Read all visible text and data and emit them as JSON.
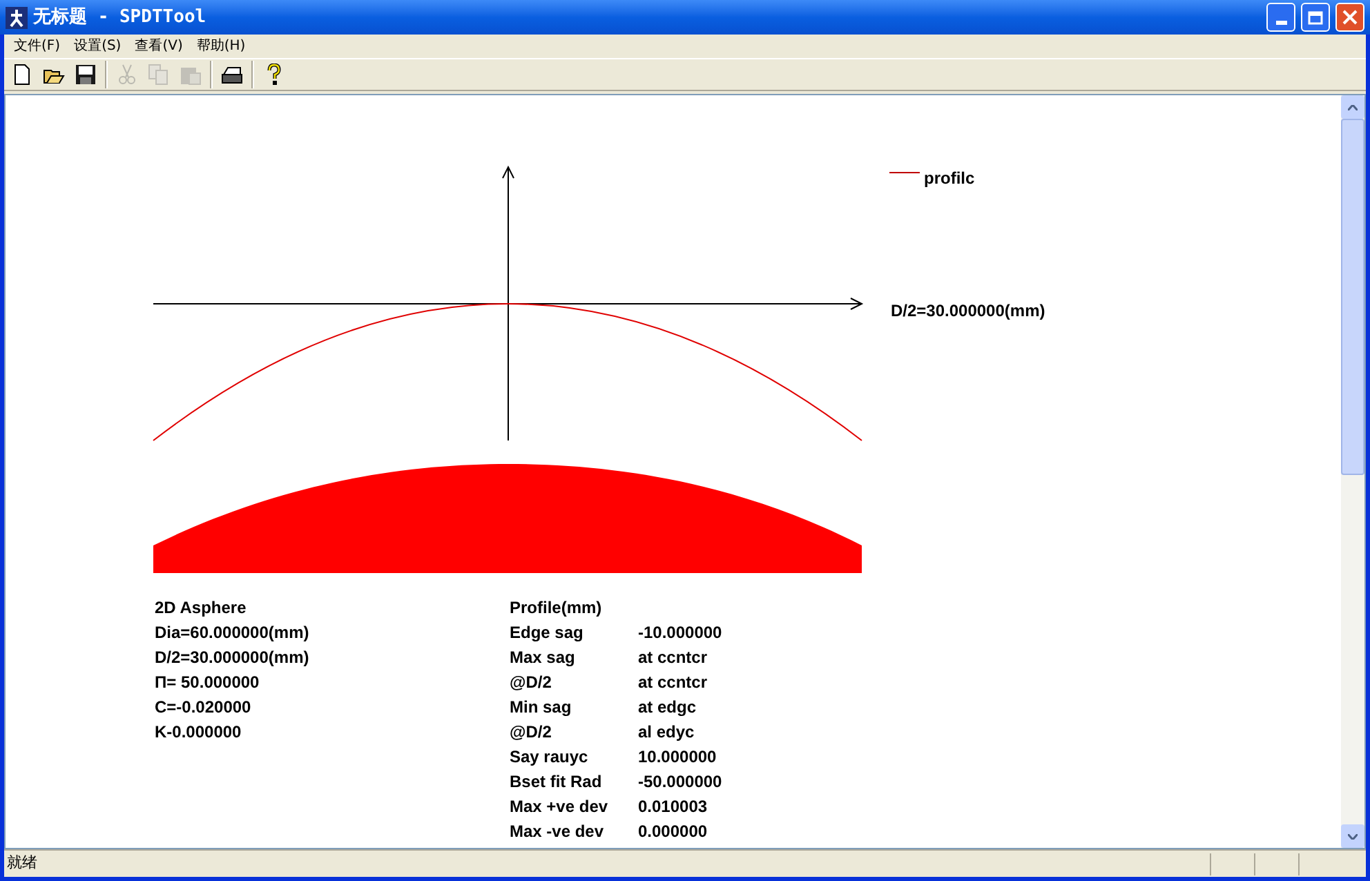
{
  "window": {
    "title": "无标题 - SPDTTool"
  },
  "menu": [
    {
      "label": "文件(F)"
    },
    {
      "label": "设置(S)"
    },
    {
      "label": "查看(V)"
    },
    {
      "label": "帮助(H)"
    }
  ],
  "toolbar": [
    {
      "kind": "new",
      "disabled": false
    },
    {
      "kind": "open",
      "disabled": false
    },
    {
      "kind": "save",
      "disabled": false
    },
    {
      "kind": "sep"
    },
    {
      "kind": "cut",
      "disabled": true
    },
    {
      "kind": "copy",
      "disabled": true
    },
    {
      "kind": "paste",
      "disabled": true
    },
    {
      "kind": "sep"
    },
    {
      "kind": "print",
      "disabled": false
    },
    {
      "kind": "sep"
    },
    {
      "kind": "help",
      "disabled": false
    }
  ],
  "plot": {
    "legend": "profilc",
    "axis_label": "D/2=30.000000(mm)"
  },
  "parameters": [
    "2D Asphere",
    "Dia=60.000000(mm)",
    "D/2=30.000000(mm)",
    "Π= 50.000000",
    "C=-0.020000",
    "K-0.000000"
  ],
  "profile": {
    "title": "Profile(mm)",
    "rows": [
      {
        "label": "Edge sag",
        "value": "-10.000000"
      },
      {
        "label": "Max sag",
        "value": "at ccntcr"
      },
      {
        "label": "@D/2",
        "value": "at ccntcr"
      },
      {
        "label": "Min sag",
        "value": "at edgc"
      },
      {
        "label": "@D/2",
        "value": "al edyc"
      },
      {
        "label": "Say rauyc",
        "value": "10.000000"
      },
      {
        "label": "Bset fit Rad",
        "value": "-50.000000"
      },
      {
        "label": "Max +ve dev",
        "value": "0.010003"
      },
      {
        "label": "Max -ve dev",
        "value": "0.000000"
      }
    ]
  },
  "status_bar": {
    "text": "就绪"
  }
}
